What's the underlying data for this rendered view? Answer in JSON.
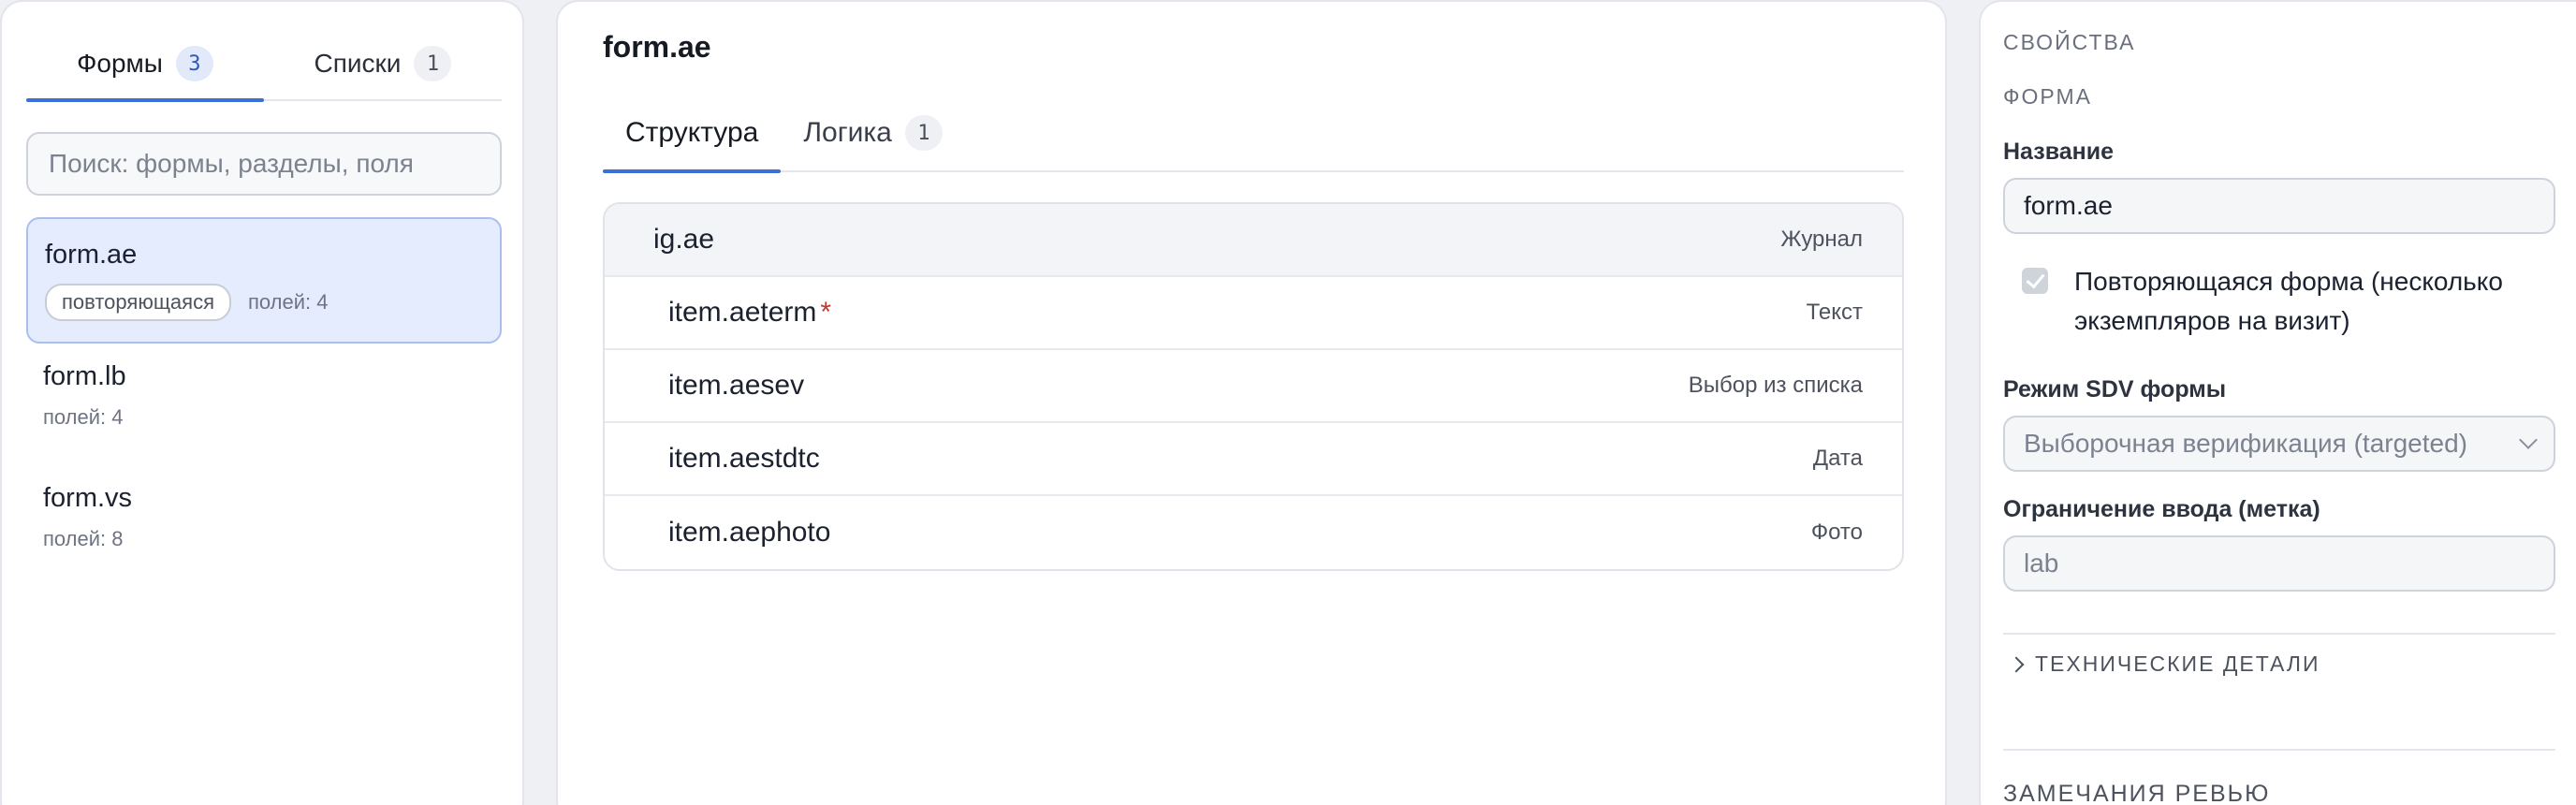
{
  "left": {
    "tabs": [
      {
        "label": "Формы",
        "count": "3"
      },
      {
        "label": "Списки",
        "count": "1"
      }
    ],
    "search_placeholder": "Поиск: формы, разделы, поля",
    "forms": [
      {
        "name": "form.ae",
        "tag": "повторяющаяся",
        "fields": "полей: 4"
      },
      {
        "name": "form.lb",
        "fields": "полей: 4"
      },
      {
        "name": "form.vs",
        "fields": "полей: 8"
      }
    ]
  },
  "center": {
    "title": "form.ae",
    "tabs": [
      {
        "label": "Структура"
      },
      {
        "label": "Логика",
        "count": "1"
      }
    ],
    "rows": [
      {
        "name": "ig.ae",
        "type": "Журнал"
      },
      {
        "name": "item.aeterm",
        "required": "*",
        "type": "Текст"
      },
      {
        "name": "item.aesev",
        "type": "Выбор из списка"
      },
      {
        "name": "item.aestdtc",
        "type": "Дата"
      },
      {
        "name": "item.aephoto",
        "type": "Фото"
      }
    ]
  },
  "right": {
    "section_properties": "СВОЙСТВА",
    "section_form": "ФОРМА",
    "name_label": "Название",
    "name_value": "form.ae",
    "repeat_label": "Повторяющаяся форма (несколько экземпляров на визит)",
    "sdv_label": "Режим SDV формы",
    "sdv_value": "Выборочная верификация (targeted)",
    "restriction_label": "Ограничение ввода (метка)",
    "restriction_value": "lab",
    "tech_details": "ТЕХНИЧЕСКИЕ ДЕТАЛИ",
    "review_notes": "ЗАМЕЧАНИЯ РЕВЬЮ"
  }
}
